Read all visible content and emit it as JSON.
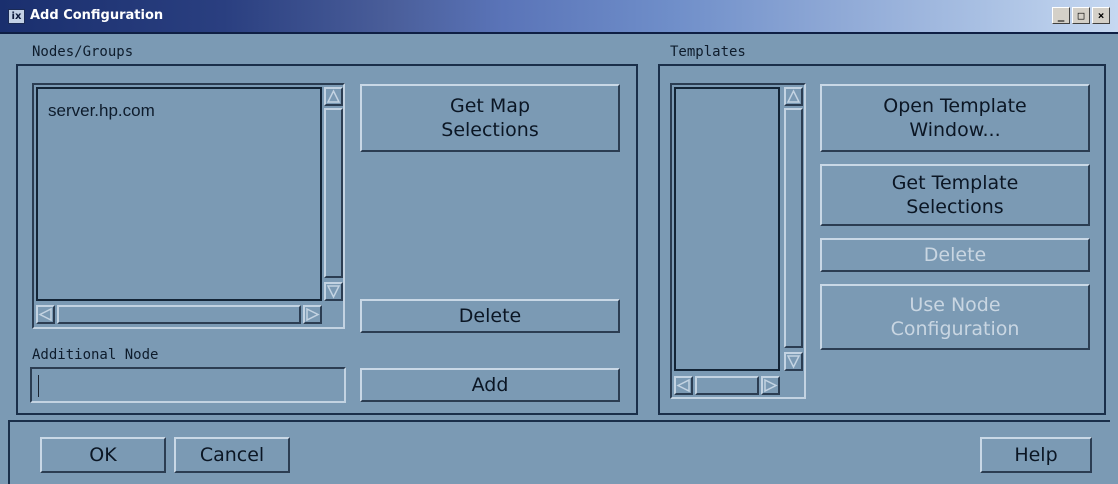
{
  "window": {
    "title": "Add Configuration",
    "app_icon": "ix-icon",
    "controls": {
      "minimize": "_",
      "maximize": "□",
      "close": "×"
    }
  },
  "nodes_groups": {
    "label": "Nodes/Groups",
    "list_items": [
      "server.hp.com"
    ],
    "get_map_selections": "Get Map\nSelections",
    "delete": "Delete",
    "additional_node_label": "Additional Node",
    "additional_node_value": "",
    "add": "Add"
  },
  "templates": {
    "label": "Templates",
    "list_items": [],
    "open_template_window": "Open Template\nWindow...",
    "get_template_selections": "Get Template\nSelections",
    "delete": "Delete",
    "use_node_configuration": "Use Node\nConfiguration"
  },
  "footer": {
    "ok": "OK",
    "cancel": "Cancel",
    "help": "Help"
  }
}
